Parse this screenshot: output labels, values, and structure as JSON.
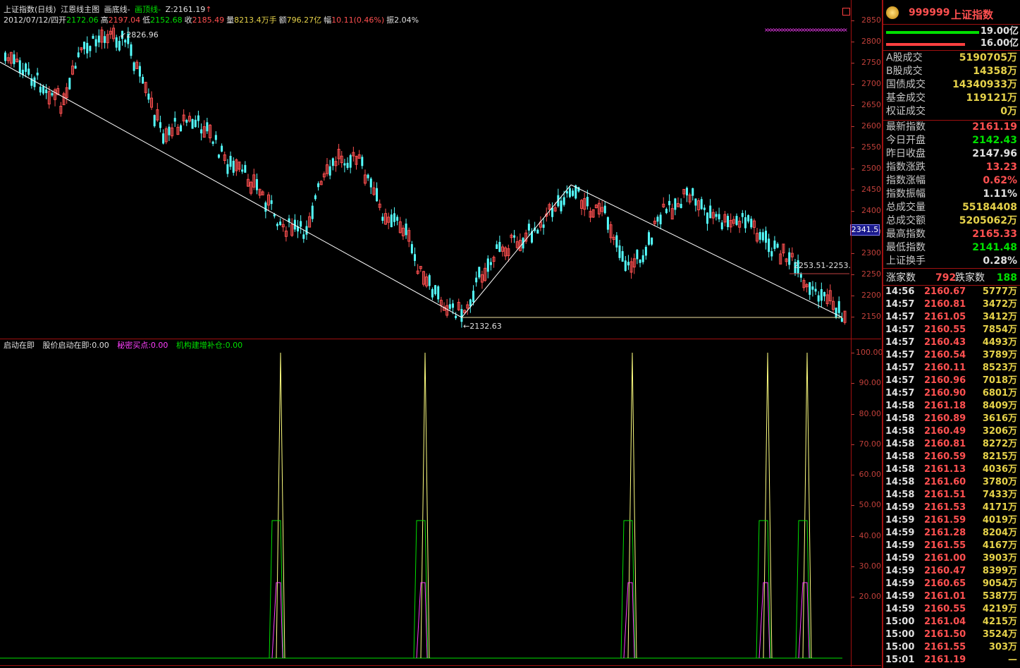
{
  "colors": {
    "up": "#ff5050",
    "down": "#54ffff",
    "green": "#00e000",
    "yellow": "#e6d24a",
    "magenta": "#ff40ff",
    "frame": "#a01010",
    "white": "#e0e0e0"
  },
  "main_chart": {
    "header_line1": {
      "title": "上证指数(日线)",
      "template": "江恩线主图",
      "draw_bottom": "画底线-",
      "draw_top": "画顶线-",
      "z_label": "Z:2161.19",
      "z_arrow": "↑"
    },
    "header_line2": {
      "date": "2012/07/12/四",
      "open_label": "开",
      "open": "2172.06",
      "high_label": "高",
      "high": "2197.04",
      "low_label": "低",
      "low": "2152.68",
      "close_label": "收",
      "close": "2185.49",
      "vol_label": "量",
      "vol": "8213.4万手",
      "amt_label": "额",
      "amt": "796.27亿",
      "range_label": "幅",
      "range": "10.11(0.46%)",
      "amp_label": "振",
      "amp": "2.04%"
    },
    "annotations": {
      "high_mark": "2826.96",
      "low_mark": "2132.63",
      "level_mark": "2253.51-2253.",
      "current_price_box": "2341.5"
    },
    "y_ticks": [
      "2850",
      "2800",
      "2750",
      "2700",
      "2650",
      "2600",
      "2550",
      "2500",
      "2450",
      "2400",
      "2350",
      "2300",
      "2250",
      "2200",
      "2150"
    ]
  },
  "sub_chart": {
    "legend": {
      "l1": "启动在即",
      "l2": "股价启动在即:0.00",
      "l3": "秘密买点:0.00",
      "l4": "机构建增补仓:0.00"
    },
    "y_ticks": [
      "100.00",
      "90.00",
      "80.00",
      "70.00",
      "60.00",
      "50.00",
      "40.00",
      "30.00",
      "20.00"
    ]
  },
  "right_panel": {
    "code": "999999",
    "name": "上证指数",
    "bar1_value": "19.00亿",
    "bar2_value": "16.00亿",
    "stats": [
      {
        "k": "A股成交",
        "v": "5190705万",
        "c": "#e6d24a"
      },
      {
        "k": "B股成交",
        "v": "14358万",
        "c": "#e6d24a"
      },
      {
        "k": "国债成交",
        "v": "14340933万",
        "c": "#e6d24a"
      },
      {
        "k": "基金成交",
        "v": "119121万",
        "c": "#e6d24a"
      },
      {
        "k": "权证成交",
        "v": "0万",
        "c": "#e6d24a"
      },
      {
        "k": "最新指数",
        "v": "2161.19",
        "c": "#ff5050"
      },
      {
        "k": "今日开盘",
        "v": "2142.43",
        "c": "#00e000"
      },
      {
        "k": "昨日收盘",
        "v": "2147.96",
        "c": "#e0e0e0"
      },
      {
        "k": "指数涨跌",
        "v": "13.23",
        "c": "#ff5050"
      },
      {
        "k": "指数涨幅",
        "v": "0.62%",
        "c": "#ff5050"
      },
      {
        "k": "指数振幅",
        "v": "1.11%",
        "c": "#e0e0e0"
      },
      {
        "k": "总成交量",
        "v": "55184408",
        "c": "#e6d24a"
      },
      {
        "k": "总成交额",
        "v": "5205062万",
        "c": "#e6d24a"
      },
      {
        "k": "最高指数",
        "v": "2165.33",
        "c": "#ff5050"
      },
      {
        "k": "最低指数",
        "v": "2141.48",
        "c": "#00e000"
      },
      {
        "k": "上证换手",
        "v": "0.28%",
        "c": "#e0e0e0"
      }
    ],
    "updown": {
      "up_label": "涨家数",
      "up": "792",
      "down_label": "跌家数",
      "down": "188"
    },
    "ticks": [
      {
        "t": "14:56",
        "p": "2160.67",
        "v": "5777万"
      },
      {
        "t": "14:57",
        "p": "2160.81",
        "v": "3472万"
      },
      {
        "t": "14:57",
        "p": "2161.05",
        "v": "3412万"
      },
      {
        "t": "14:57",
        "p": "2160.55",
        "v": "7854万"
      },
      {
        "t": "14:57",
        "p": "2160.43",
        "v": "4493万"
      },
      {
        "t": "14:57",
        "p": "2160.54",
        "v": "3789万"
      },
      {
        "t": "14:57",
        "p": "2160.11",
        "v": "8523万"
      },
      {
        "t": "14:57",
        "p": "2160.96",
        "v": "7018万"
      },
      {
        "t": "14:57",
        "p": "2160.90",
        "v": "6801万"
      },
      {
        "t": "14:58",
        "p": "2161.18",
        "v": "8409万"
      },
      {
        "t": "14:58",
        "p": "2160.89",
        "v": "3616万"
      },
      {
        "t": "14:58",
        "p": "2160.49",
        "v": "3206万"
      },
      {
        "t": "14:58",
        "p": "2160.81",
        "v": "8272万"
      },
      {
        "t": "14:58",
        "p": "2160.59",
        "v": "8215万"
      },
      {
        "t": "14:58",
        "p": "2161.13",
        "v": "4036万"
      },
      {
        "t": "14:58",
        "p": "2161.60",
        "v": "3780万"
      },
      {
        "t": "14:58",
        "p": "2161.51",
        "v": "7433万"
      },
      {
        "t": "14:59",
        "p": "2161.53",
        "v": "4171万"
      },
      {
        "t": "14:59",
        "p": "2161.59",
        "v": "4019万"
      },
      {
        "t": "14:59",
        "p": "2161.28",
        "v": "8204万"
      },
      {
        "t": "14:59",
        "p": "2161.55",
        "v": "4167万"
      },
      {
        "t": "14:59",
        "p": "2161.00",
        "v": "3903万"
      },
      {
        "t": "14:59",
        "p": "2160.47",
        "v": "8399万"
      },
      {
        "t": "14:59",
        "p": "2160.65",
        "v": "9054万"
      },
      {
        "t": "14:59",
        "p": "2161.01",
        "v": "5387万"
      },
      {
        "t": "14:59",
        "p": "2160.55",
        "v": "4219万"
      },
      {
        "t": "15:00",
        "p": "2161.04",
        "v": "4215万"
      },
      {
        "t": "15:00",
        "p": "2161.50",
        "v": "3524万"
      },
      {
        "t": "15:00",
        "p": "2161.55",
        "v": "303万"
      },
      {
        "t": "15:01",
        "p": "2161.19",
        "v": "—"
      }
    ]
  }
}
